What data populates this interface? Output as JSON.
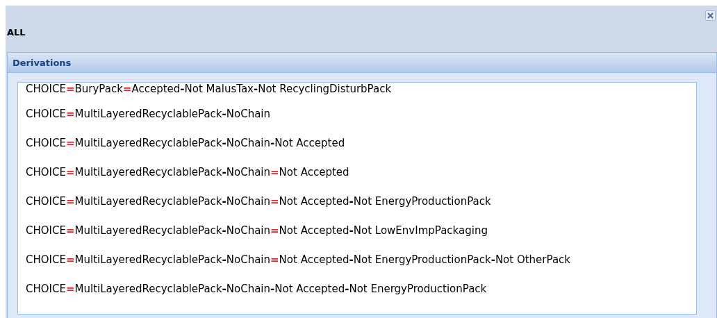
{
  "window": {
    "title": "ALL"
  },
  "panel": {
    "title": "Derivations",
    "derivations": [
      {
        "parts": [
          {
            "kind": "term",
            "text": "CHOICE"
          },
          {
            "kind": "equals",
            "text": "="
          },
          {
            "kind": "term",
            "text": "BuryPack"
          },
          {
            "kind": "equals",
            "text": "="
          },
          {
            "kind": "term",
            "text": "Accepted"
          },
          {
            "kind": "dash",
            "text": "-"
          },
          {
            "kind": "term",
            "text": "Not MalusTax"
          },
          {
            "kind": "dash",
            "text": "-"
          },
          {
            "kind": "term",
            "text": "Not RecyclingDisturbPack"
          }
        ]
      },
      {
        "parts": [
          {
            "kind": "term",
            "text": "CHOICE"
          },
          {
            "kind": "equals",
            "text": "="
          },
          {
            "kind": "term",
            "text": "MultiLayeredRecyclablePack"
          },
          {
            "kind": "dash",
            "text": "-"
          },
          {
            "kind": "term",
            "text": "NoChain"
          }
        ]
      },
      {
        "parts": [
          {
            "kind": "term",
            "text": "CHOICE"
          },
          {
            "kind": "equals",
            "text": "="
          },
          {
            "kind": "term",
            "text": "MultiLayeredRecyclablePack"
          },
          {
            "kind": "dash",
            "text": "-"
          },
          {
            "kind": "term",
            "text": "NoChain"
          },
          {
            "kind": "dash",
            "text": "-"
          },
          {
            "kind": "term",
            "text": "Not Accepted"
          }
        ]
      },
      {
        "parts": [
          {
            "kind": "term",
            "text": "CHOICE"
          },
          {
            "kind": "equals",
            "text": "="
          },
          {
            "kind": "term",
            "text": "MultiLayeredRecyclablePack"
          },
          {
            "kind": "dash",
            "text": "-"
          },
          {
            "kind": "term",
            "text": "NoChain"
          },
          {
            "kind": "equals",
            "text": "="
          },
          {
            "kind": "term",
            "text": "Not Accepted"
          }
        ]
      },
      {
        "parts": [
          {
            "kind": "term",
            "text": "CHOICE"
          },
          {
            "kind": "equals",
            "text": "="
          },
          {
            "kind": "term",
            "text": "MultiLayeredRecyclablePack"
          },
          {
            "kind": "dash",
            "text": "-"
          },
          {
            "kind": "term",
            "text": "NoChain"
          },
          {
            "kind": "equals",
            "text": "="
          },
          {
            "kind": "term",
            "text": "Not Accepted"
          },
          {
            "kind": "dash",
            "text": "-"
          },
          {
            "kind": "term",
            "text": "Not EnergyProductionPack"
          }
        ]
      },
      {
        "parts": [
          {
            "kind": "term",
            "text": "CHOICE"
          },
          {
            "kind": "equals",
            "text": "="
          },
          {
            "kind": "term",
            "text": "MultiLayeredRecyclablePack"
          },
          {
            "kind": "dash",
            "text": "-"
          },
          {
            "kind": "term",
            "text": "NoChain"
          },
          {
            "kind": "equals",
            "text": "="
          },
          {
            "kind": "term",
            "text": "Not Accepted"
          },
          {
            "kind": "dash",
            "text": "-"
          },
          {
            "kind": "term",
            "text": "Not LowEnvImpPackaging"
          }
        ]
      },
      {
        "parts": [
          {
            "kind": "term",
            "text": "CHOICE"
          },
          {
            "kind": "equals",
            "text": "="
          },
          {
            "kind": "term",
            "text": "MultiLayeredRecyclablePack"
          },
          {
            "kind": "dash",
            "text": "-"
          },
          {
            "kind": "term",
            "text": "NoChain"
          },
          {
            "kind": "equals",
            "text": "="
          },
          {
            "kind": "term",
            "text": "Not Accepted"
          },
          {
            "kind": "dash",
            "text": "-"
          },
          {
            "kind": "term",
            "text": "Not EnergyProductionPack"
          },
          {
            "kind": "dash",
            "text": "-"
          },
          {
            "kind": "term",
            "text": "Not OtherPack"
          }
        ]
      },
      {
        "parts": [
          {
            "kind": "term",
            "text": "CHOICE"
          },
          {
            "kind": "equals",
            "text": "="
          },
          {
            "kind": "term",
            "text": "MultiLayeredRecyclablePack"
          },
          {
            "kind": "dash",
            "text": "-"
          },
          {
            "kind": "term",
            "text": "NoChain"
          },
          {
            "kind": "dash",
            "text": "-"
          },
          {
            "kind": "term",
            "text": "Not Accepted"
          },
          {
            "kind": "dash",
            "text": "-"
          },
          {
            "kind": "term",
            "text": "Not EnergyProductionPack"
          }
        ]
      }
    ]
  }
}
